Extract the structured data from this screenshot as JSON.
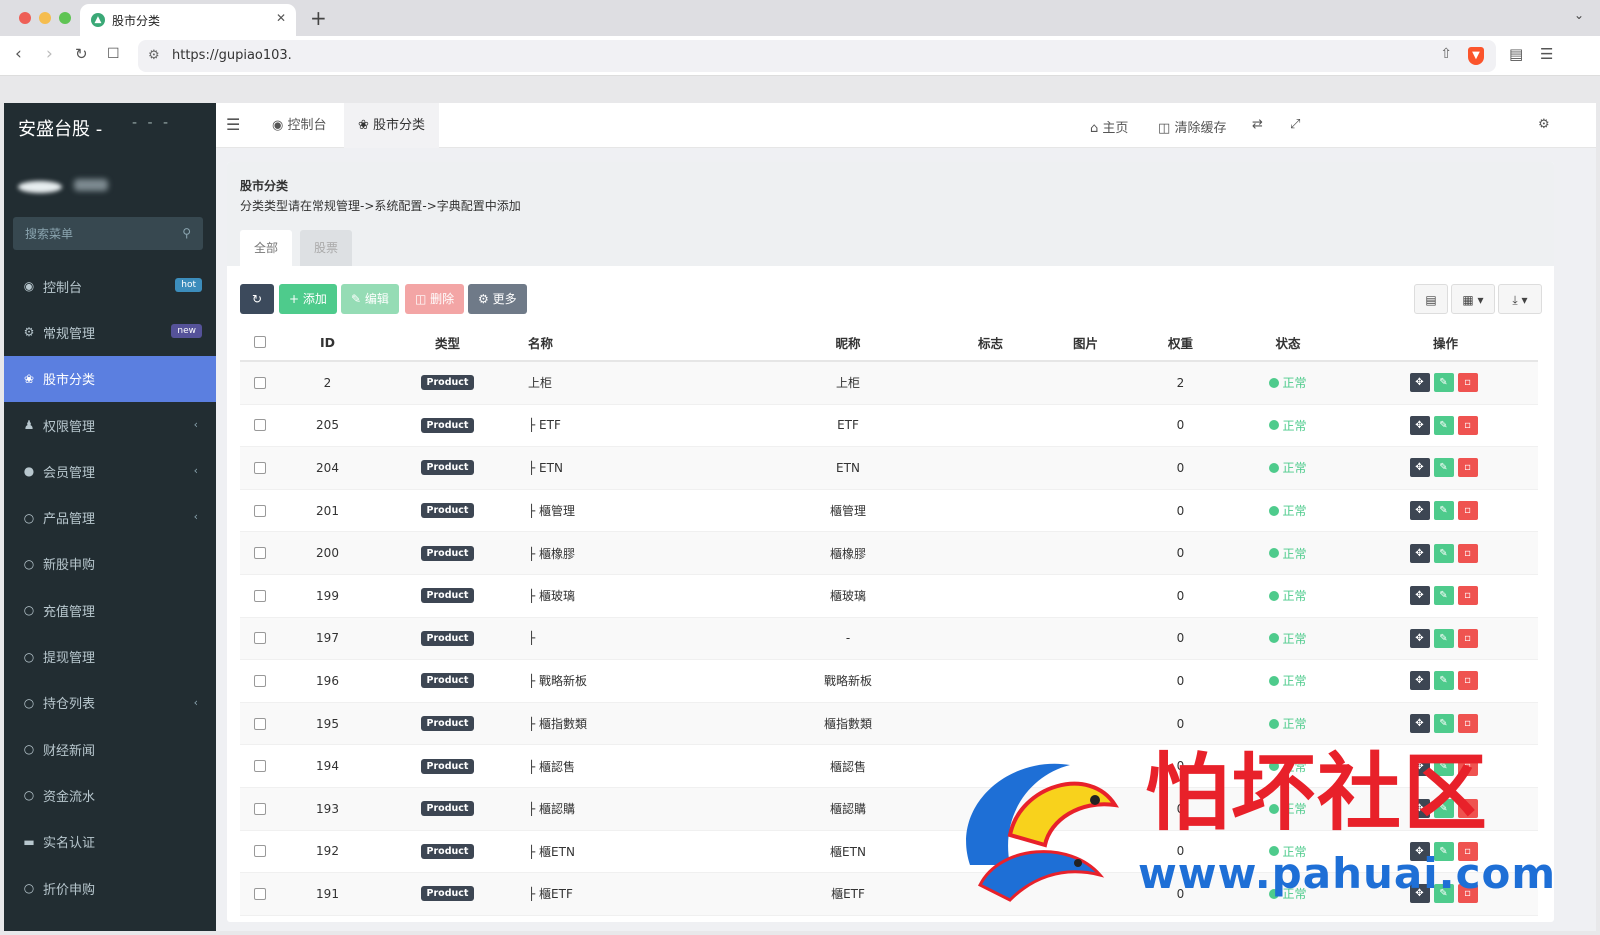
{
  "browser": {
    "tab_title": "股市分类",
    "url": "https://gupiao103."
  },
  "sidebar": {
    "brand": "安盛台股 -",
    "brand_suffix": "- - -",
    "search_placeholder": "搜索菜单",
    "items": [
      {
        "label": "控制台",
        "icon": "dashboard-icon",
        "badge": "hot"
      },
      {
        "label": "常规管理",
        "icon": "cogs-icon",
        "badge": "new"
      },
      {
        "label": "股市分类",
        "icon": "leaf-icon",
        "active": true
      },
      {
        "label": "权限管理",
        "icon": "group-icon",
        "chevron": true
      },
      {
        "label": "会员管理",
        "icon": "user-circle-icon",
        "chevron": true
      },
      {
        "label": "产品管理",
        "icon": "circle-icon",
        "chevron": true
      },
      {
        "label": "新股申购",
        "icon": "circle-icon"
      },
      {
        "label": "充值管理",
        "icon": "circle-icon"
      },
      {
        "label": "提现管理",
        "icon": "circle-icon"
      },
      {
        "label": "持仓列表",
        "icon": "circle-icon",
        "chevron": true
      },
      {
        "label": "财经新闻",
        "icon": "circle-icon"
      },
      {
        "label": "资金流水",
        "icon": "circle-icon"
      },
      {
        "label": "实名认证",
        "icon": "id-card-icon"
      },
      {
        "label": "折价申购",
        "icon": "circle-icon"
      }
    ]
  },
  "topnav": {
    "tabs": [
      "控制台",
      "股市分类"
    ],
    "home": "主页",
    "clear_cache": "清除缓存"
  },
  "panel": {
    "title": "股市分类",
    "description": "分类类型请在常规管理->系统配置->字典配置中添加",
    "tabs": [
      "全部",
      "股票"
    ]
  },
  "toolbar": {
    "add": "添加",
    "edit": "编辑",
    "delete": "删除",
    "more": "更多"
  },
  "table": {
    "headers": [
      "ID",
      "类型",
      "名称",
      "昵称",
      "标志",
      "图片",
      "权重",
      "状态",
      "操作"
    ],
    "type_label": "Product",
    "status_label": "正常",
    "rows": [
      {
        "id": "2",
        "name": "上柜",
        "nickname": "上柜",
        "weight": "2"
      },
      {
        "id": "205",
        "name": "├ ETF",
        "nickname": "ETF",
        "weight": "0"
      },
      {
        "id": "204",
        "name": "├ ETN",
        "nickname": "ETN",
        "weight": "0"
      },
      {
        "id": "201",
        "name": "├ 櫃管理",
        "nickname": "櫃管理",
        "weight": "0"
      },
      {
        "id": "200",
        "name": "├ 櫃橡膠",
        "nickname": "櫃橡膠",
        "weight": "0"
      },
      {
        "id": "199",
        "name": "├ 櫃玻璃",
        "nickname": "櫃玻璃",
        "weight": "0"
      },
      {
        "id": "197",
        "name": "├",
        "nickname": "-",
        "weight": "0"
      },
      {
        "id": "196",
        "name": "├ 戰略新板",
        "nickname": "戰略新板",
        "weight": "0"
      },
      {
        "id": "195",
        "name": "├ 櫃指數類",
        "nickname": "櫃指數類",
        "weight": "0"
      },
      {
        "id": "194",
        "name": "├ 櫃認售",
        "nickname": "櫃認售",
        "weight": "0"
      },
      {
        "id": "193",
        "name": "├ 櫃認購",
        "nickname": "櫃認購",
        "weight": "0"
      },
      {
        "id": "192",
        "name": "├ 櫃ETN",
        "nickname": "櫃ETN",
        "weight": "0"
      },
      {
        "id": "191",
        "name": "├ 櫃ETF",
        "nickname": "櫃ETF",
        "weight": "0"
      }
    ]
  },
  "watermark": {
    "text": "怕坏社区",
    "url": "www.pahuai.com"
  },
  "colors": {
    "sidebar_bg": "#222d32",
    "active_menu": "#5b7fe0",
    "success": "#4ecb8c",
    "danger": "#ef5350",
    "dark": "#3d4653"
  }
}
